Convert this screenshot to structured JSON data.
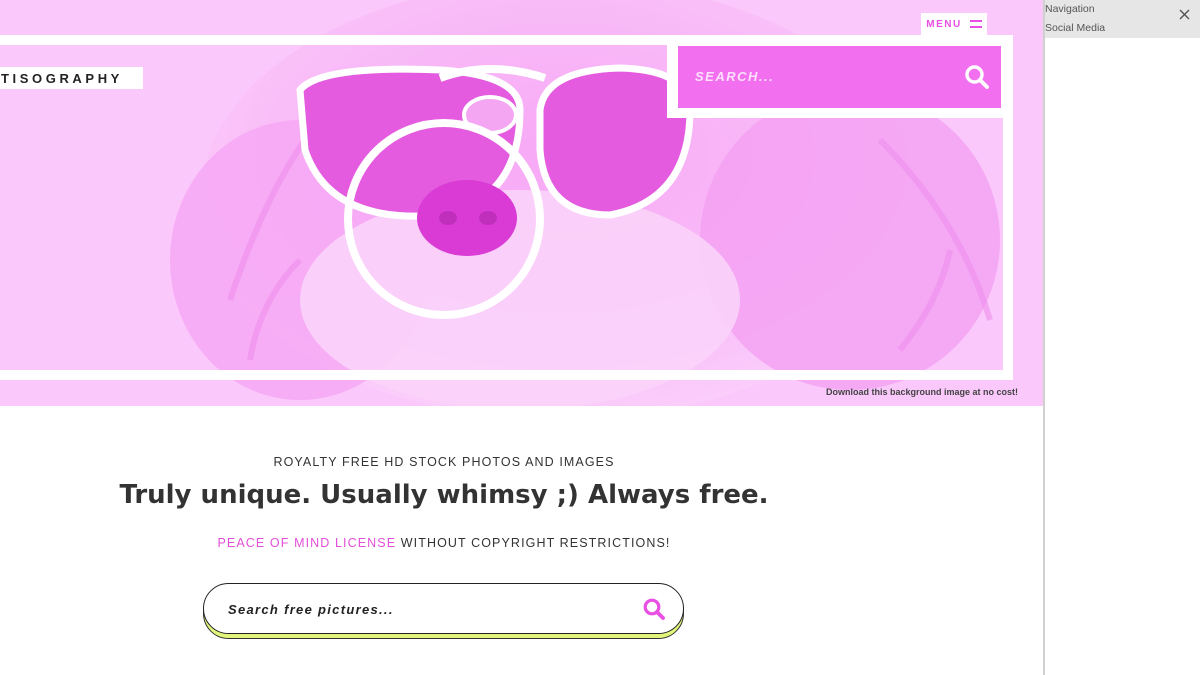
{
  "header": {
    "menu_label": "MENU",
    "logo_text": "TISOGRAPHY",
    "search_placeholder": "SEARCH...",
    "background_link": "Download this background image at no cost!"
  },
  "main": {
    "tagline": "ROYALTY FREE HD STOCK PHOTOS AND IMAGES",
    "headline": "Truly unique. Usually whimsy ;) Always free.",
    "license_link": "PEACE OF MIND LICENSE",
    "license_suffix": " WITHOUT COPYRIGHT RESTRICTIONS!",
    "search_placeholder": "Search free pictures..."
  },
  "side_panel": {
    "items": [
      {
        "label": "Navigation"
      },
      {
        "label": "Social Media"
      }
    ]
  },
  "icons": {
    "menu": "hamburger-icon",
    "search": "search-icon",
    "close": "close-icon"
  },
  "colors": {
    "accent": "#e84fe3",
    "hero_background": "#fbc8fb",
    "search_highlight": "#e2f57a"
  }
}
